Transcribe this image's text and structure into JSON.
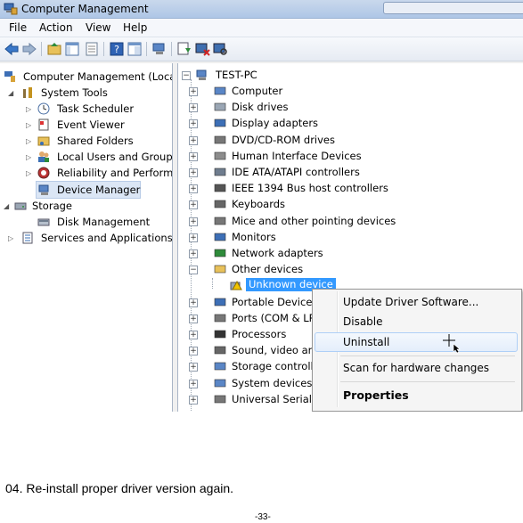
{
  "window": {
    "title": "Computer Management"
  },
  "menu": [
    "File",
    "Action",
    "View",
    "Help"
  ],
  "left_tree": {
    "root": "Computer Management (Local",
    "system_tools": "System Tools",
    "items": [
      "Task Scheduler",
      "Event Viewer",
      "Shared Folders",
      "Local Users and Groups",
      "Reliability and Performa",
      "Device Manager"
    ],
    "storage": "Storage",
    "disk_management": "Disk Management",
    "services": "Services and Applications"
  },
  "device_tree": {
    "root": "TEST-PC",
    "categories_top": [
      "Computer",
      "Disk drives",
      "Display adapters",
      "DVD/CD-ROM drives",
      "Human Interface Devices",
      "IDE ATA/ATAPI controllers",
      "IEEE 1394 Bus host controllers",
      "Keyboards",
      "Mice and other pointing devices",
      "Monitors",
      "Network adapters"
    ],
    "other_devices": "Other devices",
    "unknown_device": "Unknown device",
    "categories_bottom": [
      "Portable Devices",
      "Ports (COM & LP",
      "Processors",
      "Sound, video and",
      "Storage controlle",
      "System devices",
      "Universal Serial B"
    ]
  },
  "context_menu": {
    "update": "Update Driver Software...",
    "disable": "Disable",
    "uninstall": "Uninstall",
    "scan": "Scan for hardware changes",
    "properties": "Properties"
  },
  "caption": "04. Re-install proper driver version again.",
  "page_number": "-33-"
}
